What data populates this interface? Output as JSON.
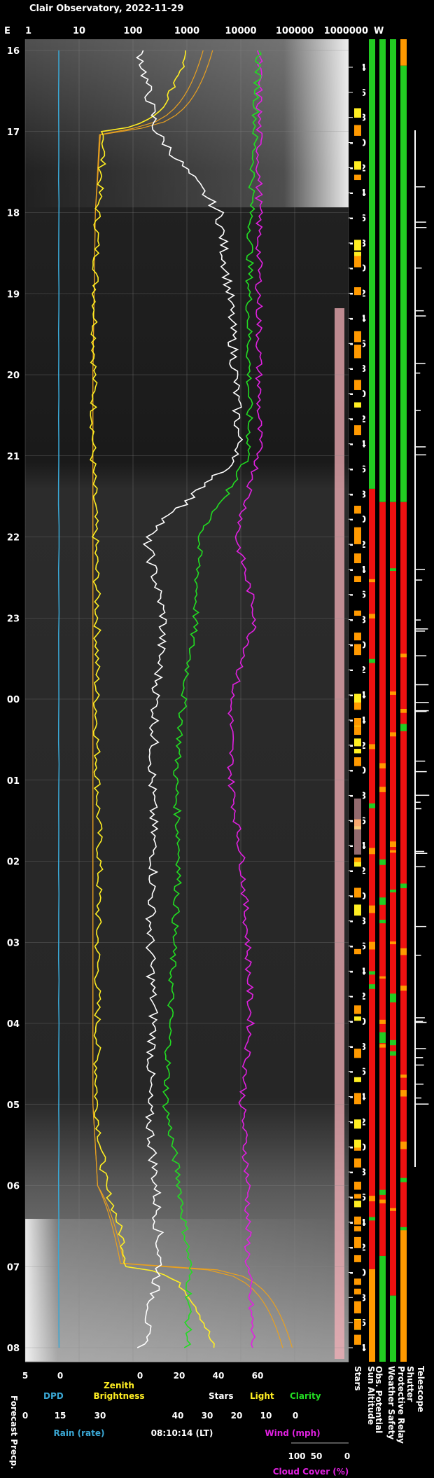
{
  "title": "Clair Observatory, 2022-11-29",
  "edge_labels": {
    "left": "E",
    "right": "W"
  },
  "top_axis_ticks": [
    "1",
    "10",
    "100",
    "1000",
    "10000",
    "100000",
    "1000000"
  ],
  "hour_ticks": [
    "16",
    "17",
    "18",
    "19",
    "20",
    "21",
    "22",
    "23",
    "00",
    "01",
    "02",
    "03",
    "04",
    "05",
    "06",
    "07",
    "08"
  ],
  "alt_ticks": [
    "-4",
    "-6",
    "-8",
    "-10",
    "-12",
    "-14",
    "-16",
    "-18",
    "-20",
    "-22",
    "-24",
    "-26",
    "-28",
    "-30",
    "-32",
    "-34",
    "-36",
    "-38",
    "-40",
    "-42",
    "-44",
    "-46",
    "-48",
    "-50",
    "-52",
    "-54",
    "-54",
    "-52",
    "-50",
    "-48",
    "-46",
    "-44",
    "-42",
    "-40",
    "-38",
    "-36",
    "-34",
    "-32",
    "-30",
    "-28",
    "-26",
    "-24",
    "-22",
    "-20",
    "-18",
    "-16",
    "-14",
    "-12",
    "-10",
    "-8",
    "-6",
    "-4"
  ],
  "bottom": {
    "row1_ticks": [
      "5",
      "0",
      "0",
      "20",
      "40",
      "60"
    ],
    "row2_ticks": [
      "0",
      "15",
      "30",
      "40",
      "30",
      "20",
      "10",
      "0"
    ],
    "row3_ticks": [
      "100",
      "50",
      "0"
    ],
    "dpd_label": "DPD",
    "zenith_label_1": "Zenith",
    "zenith_label_2": "Brightness",
    "stars_label": "Stars",
    "light_label": "Light",
    "clarity_label": "Clarity",
    "rain_label": "Rain (rate)",
    "time_label": "08:10:14 (LT)",
    "wind_label": "Wind (mph)",
    "cloud_label": "Cloud Cover (%)",
    "forecast_label": "Forecast Precp.",
    "stars_vert": "Stars",
    "sun_alt": "Sun Altitude",
    "obs_potential": "Obs. Potential",
    "weather_safety": "Weather Safety",
    "protective_relay": "Protective Relay",
    "shutter": "Shutter",
    "telescope": "Telescope"
  },
  "colors": {
    "dpd": "#3aa7d4",
    "zenith": "#ffee22",
    "zenith_model": "#e8a020",
    "stars": "#ffffff",
    "clarity": "#22dd22",
    "cloud": "#e020e0",
    "ok": "#22cc22",
    "bad": "#ee1111",
    "warn": "#ff9900",
    "pink": "#f4b0b8"
  },
  "chart_data": {
    "type": "line",
    "title": "Clair Observatory, 2022-11-29",
    "x_axis": "local time (hours, 15:45 to 08:10)",
    "series": [
      {
        "name": "Zenith Brightness",
        "hours": [
          "16",
          "17",
          "18",
          "19",
          "20",
          "21",
          "22",
          "23",
          "00",
          "01",
          "02",
          "03",
          "04",
          "05",
          "06",
          "07",
          "08"
        ],
        "values": [
          1000,
          30,
          22,
          20,
          19,
          18,
          20,
          22,
          21,
          22,
          24,
          22,
          22,
          21,
          30,
          80,
          3000
        ]
      },
      {
        "name": "Stars",
        "hours": [
          "16",
          "17",
          "18",
          "19",
          "20",
          "21",
          "22",
          "23",
          "00",
          "01",
          "02",
          "03",
          "04",
          "05",
          "06",
          "07",
          "08"
        ],
        "values": [
          0,
          8,
          40,
          45,
          48,
          50,
          3,
          12,
          8,
          6,
          7,
          5,
          7,
          4,
          8,
          10,
          1
        ]
      },
      {
        "name": "Clarity",
        "hours": [
          "16",
          "17",
          "18",
          "19",
          "20",
          "21",
          "22",
          "23",
          "00",
          "01",
          "02",
          "03",
          "04",
          "05",
          "06",
          "07",
          "08"
        ],
        "values": [
          60,
          58,
          56,
          55,
          55,
          55,
          30,
          28,
          22,
          18,
          20,
          17,
          15,
          13,
          20,
          25,
          24
        ]
      },
      {
        "name": "Cloud Cover (%)",
        "hours": [
          "16",
          "17",
          "18",
          "19",
          "20",
          "21",
          "22",
          "23",
          "00",
          "01",
          "02",
          "03",
          "04",
          "05",
          "06",
          "07",
          "08"
        ],
        "values": [
          0,
          0,
          0,
          0,
          0,
          0,
          40,
          5,
          50,
          50,
          30,
          20,
          15,
          30,
          20,
          20,
          10
        ]
      },
      {
        "name": "Sun Altitude",
        "hours": [
          "16",
          "17",
          "18",
          "19",
          "20",
          "21",
          "22",
          "23",
          "00",
          "01",
          "02",
          "03",
          "04",
          "05",
          "06",
          "07",
          "08"
        ],
        "values": [
          -3,
          -11,
          -17,
          -26,
          -34,
          -43,
          -49,
          -53,
          -54,
          -52,
          -46,
          -41,
          -35,
          -28,
          -18,
          -10,
          -2
        ]
      }
    ],
    "status_columns": [
      {
        "name": "Obs. Potential",
        "segments": [
          [
            "ok",
            0.0,
            0.34
          ],
          [
            "bad",
            0.34,
            0.93
          ],
          [
            "warn",
            0.93,
            1.0
          ]
        ]
      },
      {
        "name": "Weather Safety",
        "segments": [
          [
            "ok",
            0.0,
            0.35
          ],
          [
            "bad",
            0.35,
            0.92
          ],
          [
            "ok",
            0.92,
            1.0
          ]
        ]
      },
      {
        "name": "Protective Relay",
        "segments": [
          [
            "ok",
            0.0,
            0.35
          ],
          [
            "bad",
            0.35,
            0.95
          ],
          [
            "ok",
            0.95,
            1.0
          ]
        ]
      },
      {
        "name": "Shutter",
        "segments": [
          [
            "warn",
            0.0,
            0.02
          ],
          [
            "ok",
            0.02,
            0.35
          ],
          [
            "bad",
            0.35,
            0.9
          ],
          [
            "warn",
            0.9,
            1.0
          ]
        ]
      }
    ]
  }
}
